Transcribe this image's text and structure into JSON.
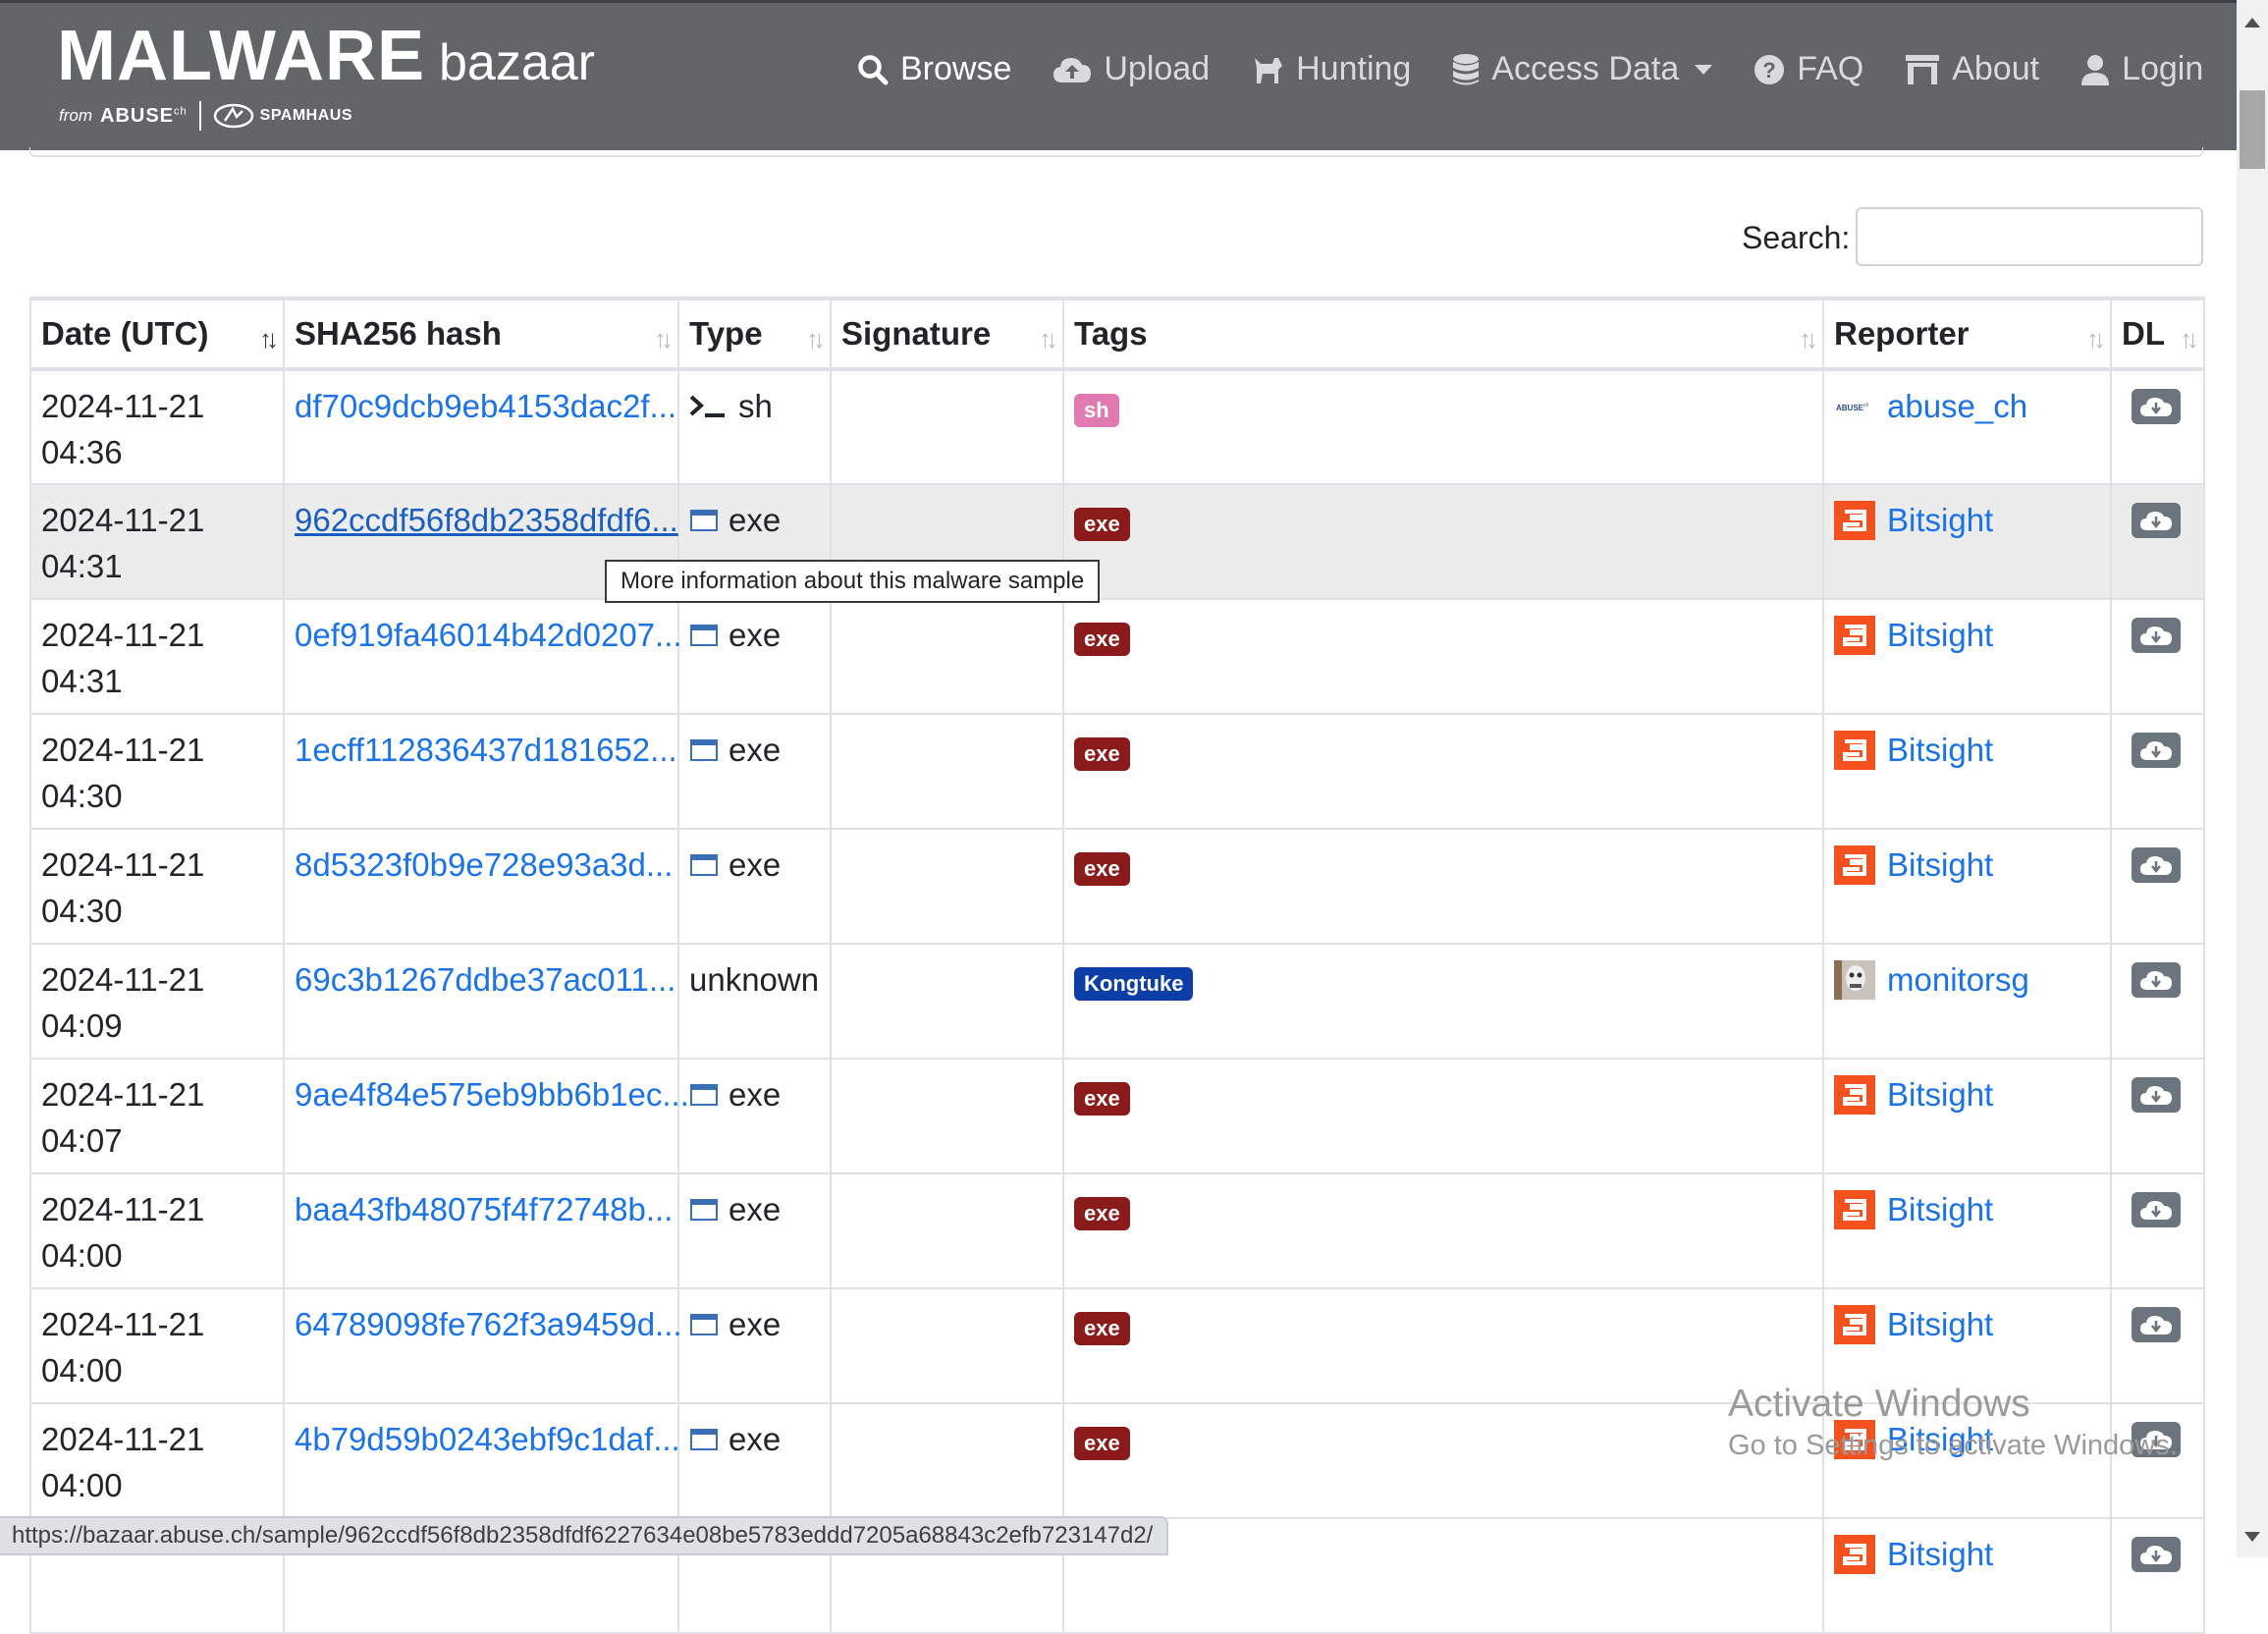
{
  "brand": {
    "main": "MALWARE",
    "sub": "bazaar",
    "from": "from",
    "abuse": "ABUSE",
    "abuse_sup": "ch",
    "spamhaus": "SPAMHAUS"
  },
  "nav": {
    "browse": "Browse",
    "upload": "Upload",
    "hunting": "Hunting",
    "access_data": "Access Data",
    "faq": "FAQ",
    "about": "About",
    "login": "Login"
  },
  "search": {
    "label": "Search:",
    "value": ""
  },
  "table": {
    "headers": {
      "date": "Date (UTC)",
      "hash": "SHA256 hash",
      "type": "Type",
      "signature": "Signature",
      "tags": "Tags",
      "reporter": "Reporter",
      "dl": "DL"
    },
    "rows": [
      {
        "date": "2024-11-21\n04:36",
        "hash": "df70c9dcb9eb4153dac2f...",
        "type": "sh",
        "tag": "sh",
        "reporter": "abuse_ch"
      },
      {
        "date": "2024-11-21\n04:31",
        "hash": "962ccdf56f8db2358dfdf6...",
        "type": "exe",
        "tag": "exe",
        "reporter": "Bitsight"
      },
      {
        "date": "2024-11-21\n04:31",
        "hash": "0ef919fa46014b42d0207...",
        "type": "exe",
        "tag": "exe",
        "reporter": "Bitsight"
      },
      {
        "date": "2024-11-21\n04:30",
        "hash": "1ecff112836437d181652...",
        "type": "exe",
        "tag": "exe",
        "reporter": "Bitsight"
      },
      {
        "date": "2024-11-21\n04:30",
        "hash": "8d5323f0b9e728e93a3d...",
        "type": "exe",
        "tag": "exe",
        "reporter": "Bitsight"
      },
      {
        "date": "2024-11-21\n04:09",
        "hash": "69c3b1267ddbe37ac011...",
        "type": "unknown",
        "tag": "Kongtuke",
        "reporter": "monitorsg"
      },
      {
        "date": "2024-11-21\n04:07",
        "hash": "9ae4f84e575eb9bb6b1ec...",
        "type": "exe",
        "tag": "exe",
        "reporter": "Bitsight"
      },
      {
        "date": "2024-11-21\n04:00",
        "hash": "baa43fb48075f4f72748b...",
        "type": "exe",
        "tag": "exe",
        "reporter": "Bitsight"
      },
      {
        "date": "2024-11-21\n04:00",
        "hash": "64789098fe762f3a9459d...",
        "type": "exe",
        "tag": "exe",
        "reporter": "Bitsight"
      },
      {
        "date": "2024-11-21\n04:00",
        "hash": "4b79d59b0243ebf9c1daf...",
        "type": "exe",
        "tag": "exe",
        "reporter": "Bitsight"
      },
      {
        "date": "",
        "hash": "",
        "type": "",
        "tag": "",
        "reporter": "Bitsight"
      }
    ]
  },
  "tooltip": "More information about this malware sample",
  "status_url": "https://bazaar.abuse.ch/sample/962ccdf56f8db2358dfdf6227634e08be5783eddd7205a68843c2efb723147d2/",
  "watermark": {
    "line1": "Activate Windows",
    "line2": "Go to Settings to activate Windows."
  },
  "colors": {
    "navbar": "#626669",
    "link": "#1a73e8",
    "tag_exe": "#8b1a1a",
    "tag_sh": "#e07ab0",
    "tag_kongtuke": "#0d3ea8",
    "bitsight": "#f4511e",
    "dl_button": "#6c757d"
  },
  "icons": {
    "browse": "search-icon",
    "upload": "cloud-upload-icon",
    "hunting": "dog-icon",
    "access_data": "database-icon",
    "faq": "question-circle-icon",
    "about": "building-icon",
    "login": "user-icon",
    "type_sh": "terminal-icon",
    "type_exe": "window-icon",
    "dl": "cloud-download-icon"
  }
}
